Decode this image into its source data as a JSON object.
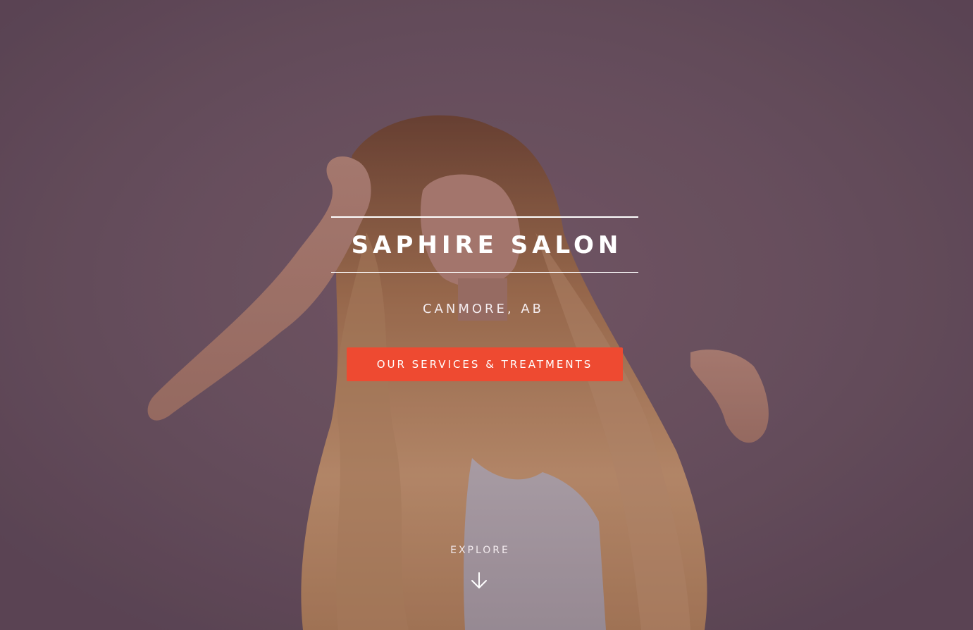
{
  "hero": {
    "title": "SAPHIRE SALON",
    "location": "CANMORE, AB",
    "cta_label": "OUR SERVICES & TREATMENTS",
    "explore_label": "EXPLORE",
    "explore_icon": "arrow-down-icon",
    "background_image": "woman-with-long-wavy-hair-photo"
  },
  "colors": {
    "accent": "#ee4a31",
    "text": "#ffffff",
    "background_tint": "#6a5560"
  }
}
